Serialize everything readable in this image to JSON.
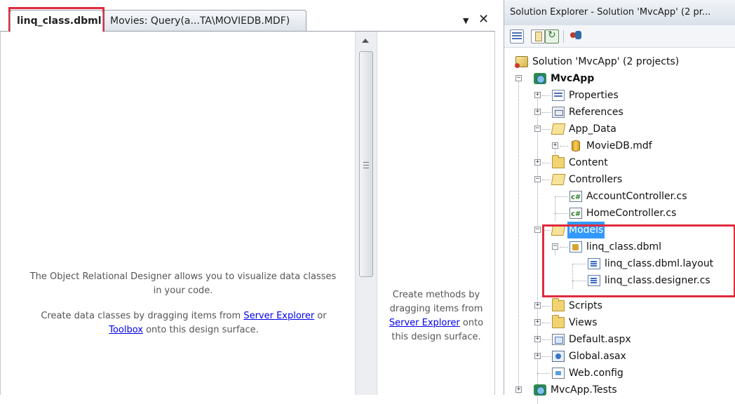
{
  "document_tabs": [
    {
      "label": "linq_class.dbml",
      "active": true
    },
    {
      "label": "Movies: Query(a...TA\\MOVIEDB.MDF)",
      "active": false
    }
  ],
  "tab_controls": {
    "dropdown_glyph": "▼",
    "close_glyph": "✕"
  },
  "designer": {
    "line1": "The Object Relational Designer allows you to visualize data classes in your code.",
    "line2_prefix": "Create data classes by dragging items from ",
    "line2_link1": "Server Explorer",
    "line2_mid": " or ",
    "line2_link2": "Toolbox",
    "line2_suffix": " onto this design surface."
  },
  "methods_pane": {
    "prefix": "Create methods by dragging items from ",
    "link": "Server Explorer",
    "suffix": " onto this design surface."
  },
  "solution_explorer": {
    "title": "Solution Explorer - Solution 'MvcApp' (2 pr...",
    "toolbar_icons": [
      "properties-icon",
      "show-all-files-icon",
      "refresh-icon",
      "view-class-diagram-icon"
    ],
    "tree": [
      {
        "label": "Solution 'MvcApp' (2 projects)",
        "icon": "solution-icon"
      },
      {
        "label": "MvcApp",
        "icon": "web-project-icon",
        "bold": true
      },
      {
        "label": "Properties",
        "icon": "properties-folder-icon"
      },
      {
        "label": "References",
        "icon": "references-icon"
      },
      {
        "label": "App_Data",
        "icon": "folder-open-icon"
      },
      {
        "label": "MovieDB.mdf",
        "icon": "database-icon"
      },
      {
        "label": "Content",
        "icon": "folder-icon"
      },
      {
        "label": "Controllers",
        "icon": "folder-open-icon"
      },
      {
        "label": "AccountController.cs",
        "icon": "csharp-file-icon"
      },
      {
        "label": "HomeController.cs",
        "icon": "csharp-file-icon"
      },
      {
        "label": "Models",
        "icon": "folder-open-icon",
        "selected": true
      },
      {
        "label": "linq_class.dbml",
        "icon": "dbml-file-icon"
      },
      {
        "label": "linq_class.dbml.layout",
        "icon": "layout-file-icon"
      },
      {
        "label": "linq_class.designer.cs",
        "icon": "designer-file-icon"
      },
      {
        "label": "Scripts",
        "icon": "folder-icon"
      },
      {
        "label": "Views",
        "icon": "folder-icon"
      },
      {
        "label": "Default.aspx",
        "icon": "aspx-file-icon"
      },
      {
        "label": "Global.asax",
        "icon": "asax-file-icon"
      },
      {
        "label": "Web.config",
        "icon": "config-file-icon"
      },
      {
        "label": "MvcApp.Tests",
        "icon": "test-project-icon"
      }
    ]
  },
  "colors": {
    "highlight_box": "#e02a3c",
    "selection": "#3399ff",
    "link": "#0000ee"
  }
}
